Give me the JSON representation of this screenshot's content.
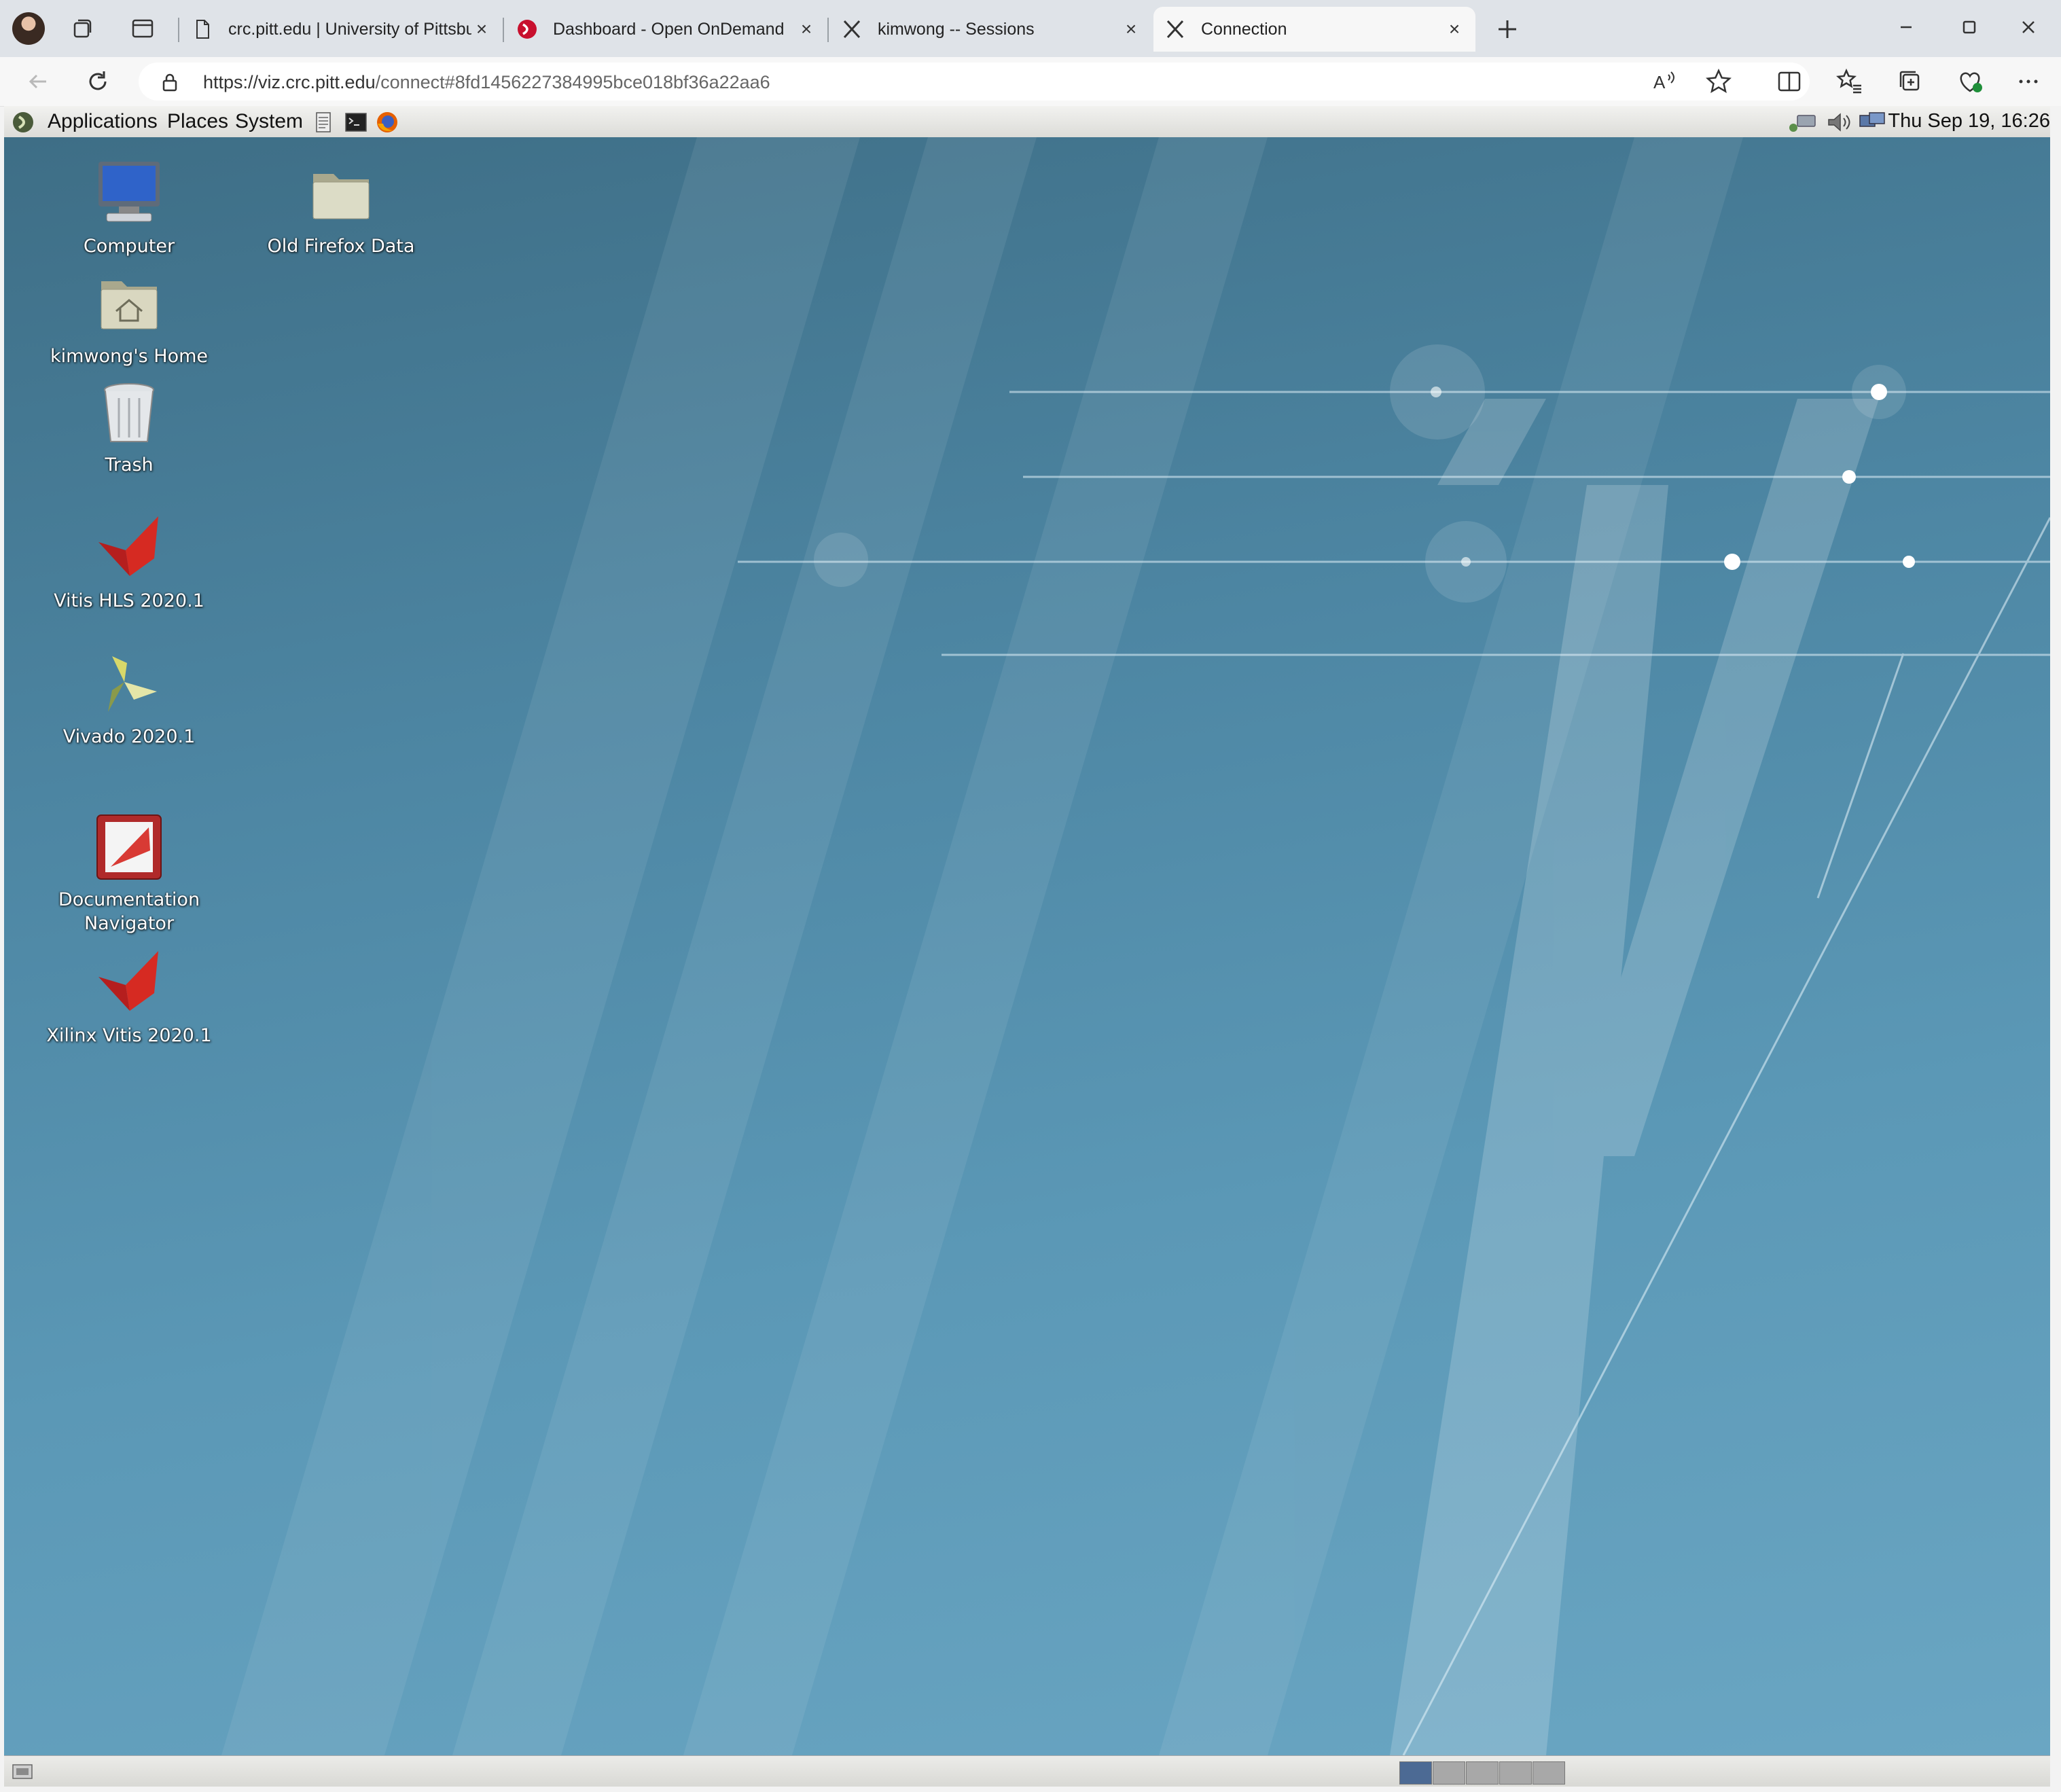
{
  "browser": {
    "tabs": [
      {
        "title": "crc.pitt.edu | University of Pittsburgh",
        "active": false
      },
      {
        "title": "Dashboard - Open OnDemand",
        "active": false
      },
      {
        "title": "kimwong -- Sessions",
        "active": false
      },
      {
        "title": "Connection",
        "active": true
      }
    ],
    "url_host": "https://viz.crc.pitt.edu",
    "url_path": "/connect#8fd1456227384995bce018bf36a22aa6"
  },
  "remote": {
    "panel": {
      "menus": [
        "Applications",
        "Places",
        "System"
      ],
      "clock": "Thu Sep 19, 16:26"
    },
    "desktop_icons": [
      {
        "label": "Computer",
        "icon": "computer-icon"
      },
      {
        "label": "Old Firefox Data",
        "icon": "folder-icon"
      },
      {
        "label": "kimwong's Home",
        "icon": "home-folder-icon"
      },
      {
        "label": "Trash",
        "icon": "trash-icon"
      },
      {
        "label": "Vitis HLS 2020.1",
        "icon": "vitis-hls-icon"
      },
      {
        "label": "Vivado 2020.1",
        "icon": "vivado-icon"
      },
      {
        "label": "Documentation Navigator",
        "icon": "docnav-icon"
      },
      {
        "label": "Xilinx Vitis 2020.1",
        "icon": "vitis-icon"
      }
    ],
    "workspaces": 5,
    "active_workspace": 1
  }
}
